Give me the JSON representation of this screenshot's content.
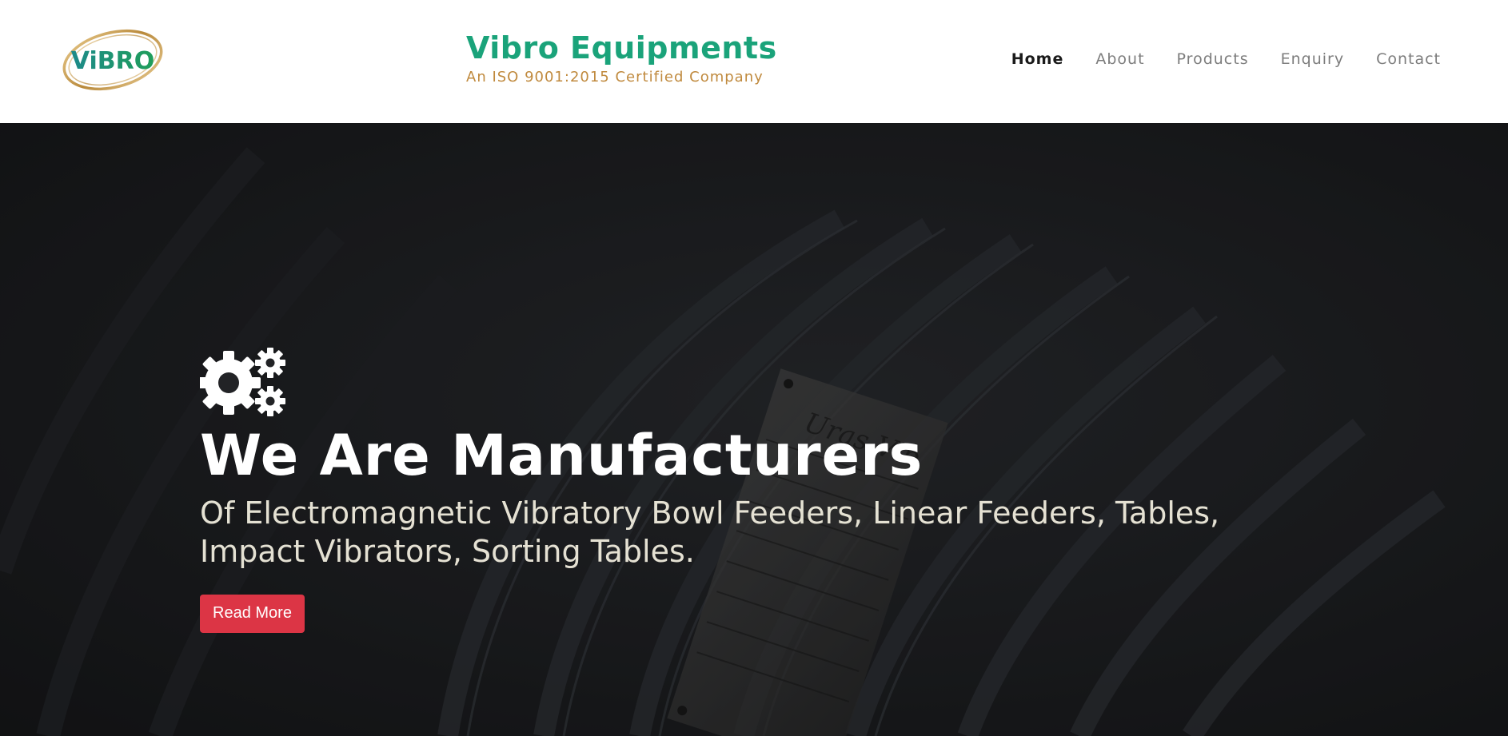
{
  "header": {
    "logo_text": "ViBRO",
    "brand_title": "Vibro Equipments",
    "brand_subtitle": "An ISO 9001:2015 Certified Company"
  },
  "nav": {
    "items": [
      {
        "label": "Home",
        "active": true
      },
      {
        "label": "About",
        "active": false
      },
      {
        "label": "Products",
        "active": false
      },
      {
        "label": "Enquiry",
        "active": false
      },
      {
        "label": "Contact",
        "active": false
      }
    ]
  },
  "hero": {
    "icon": "gears-icon",
    "title": "We Are Manufacturers",
    "subtitle": "Of Electromagnetic Vibratory Bowl Feeders, Linear Feeders, Tables, Impact Vibrators, Sorting Tables.",
    "button_label": "Read More",
    "plate_text": "Uras Vib"
  },
  "colors": {
    "brand_green": "#1aa37a",
    "brand_gold": "#c08a3e",
    "button_red": "#dc3545",
    "hero_dark": "#1b1c1e"
  }
}
